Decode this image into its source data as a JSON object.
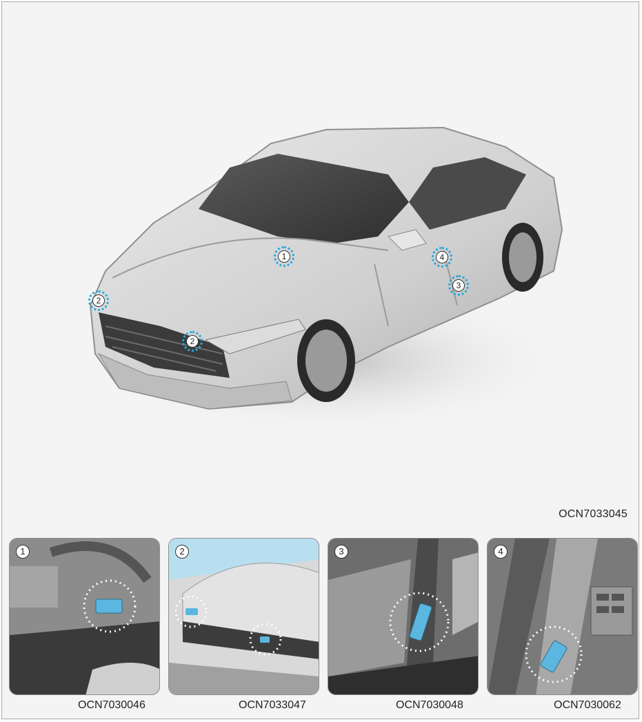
{
  "main_figure": {
    "code": "OCN7033045",
    "markers": [
      "1",
      "2",
      "2",
      "3",
      "4"
    ]
  },
  "thumbnails": [
    {
      "number": "1",
      "code": "OCN7030046"
    },
    {
      "number": "2",
      "code": "OCN7033047"
    },
    {
      "number": "3",
      "code": "OCN7030048"
    },
    {
      "number": "4",
      "code": "OCN7030062"
    }
  ],
  "colors": {
    "highlight": "#29a9e0",
    "frame_border": "#a9a9a9",
    "background": "#f4f4f4"
  }
}
